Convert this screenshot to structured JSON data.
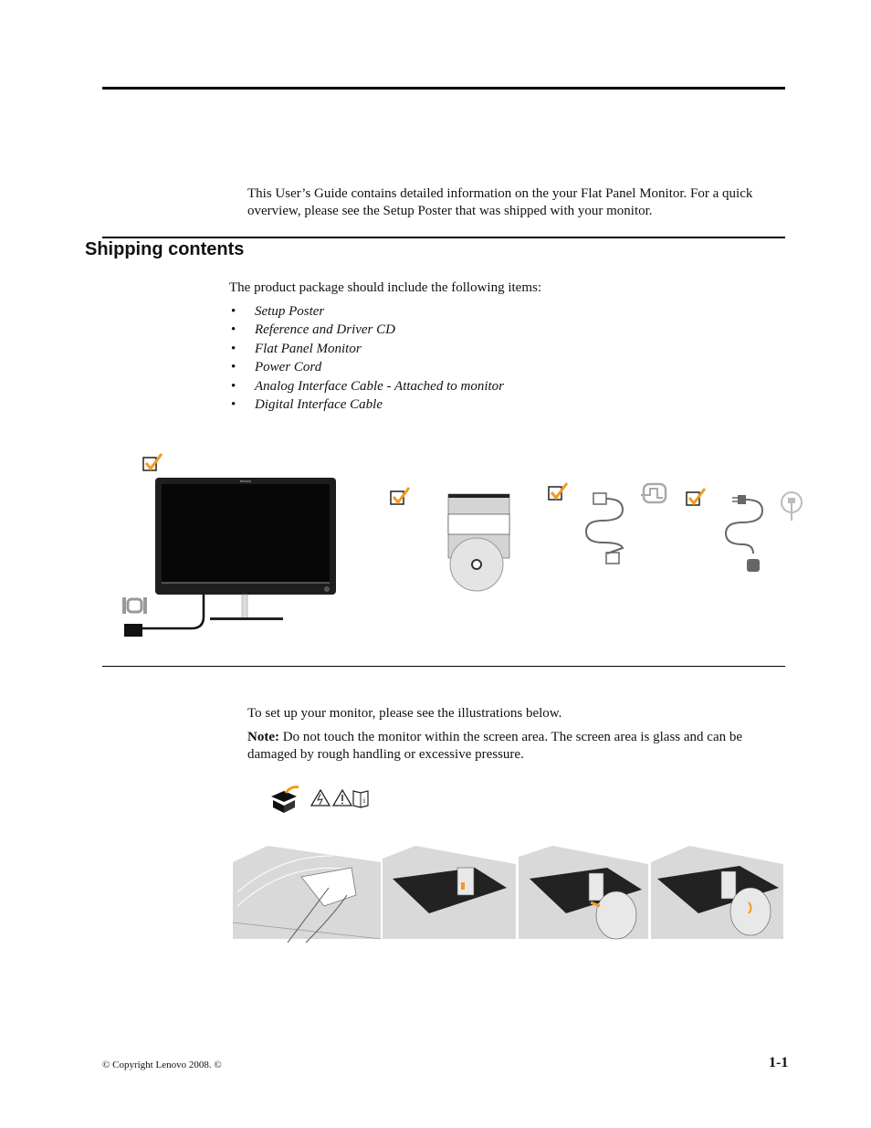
{
  "intro": "This User’s Guide contains detailed information on the your Flat Panel Monitor.  For a quick overview, please see the Setup Poster that was shipped with your monitor.",
  "section": {
    "title": "Shipping contents",
    "lead": "The product package should include the following items:",
    "items": [
      "Setup Poster",
      "Reference and Driver CD",
      "Flat Panel Monitor",
      "Power Cord",
      "Analog Interface Cable - Attached to monitor",
      "Digital Interface Cable"
    ]
  },
  "illustration": {
    "monitor_logo": "lenovo",
    "check_color": "#f39a1e"
  },
  "setup": {
    "text": "To set up your monitor, please see the illustrations below.",
    "note_label": "Note:",
    "note_text": "  Do not touch the monitor within the screen area. The screen area is glass and can be damaged by rough handling or excessive pressure.",
    "icons": [
      "unpack-box-icon",
      "electric-warning-icon",
      "warning-icon",
      "info-manual-icon"
    ]
  },
  "footer": {
    "copyright": "© Copyright Lenovo 2008. ©",
    "page": "1-1"
  }
}
